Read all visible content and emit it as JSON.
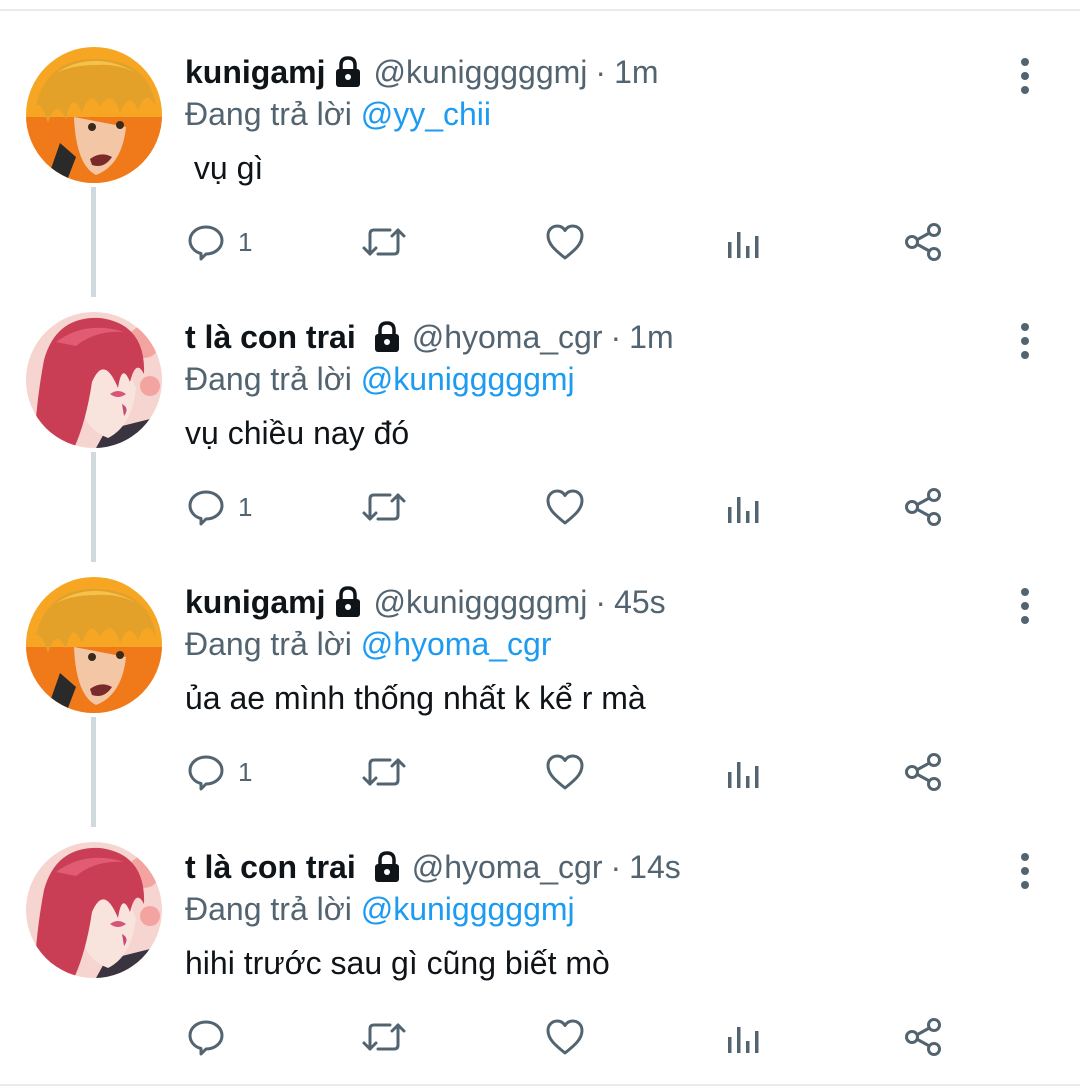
{
  "colors": {
    "text_primary": "#0f1419",
    "text_secondary": "#536471",
    "mention_blue": "#1d9bf0",
    "icon_gray": "#536471",
    "thread_line": "#cfd9de"
  },
  "icons": {
    "lock": "lock-icon",
    "more": "more-vertical-icon",
    "reply": "reply-icon",
    "retweet": "retweet-icon",
    "like": "heart-icon",
    "analytics": "analytics-icon",
    "share": "share-icon"
  },
  "tweets": [
    {
      "display_name": "kunigamj",
      "handle": "@kunigggggmj",
      "dot": "·",
      "time": "1m",
      "reply_prefix": "Đang trả lời",
      "reply_to": "@yy_chii",
      "text": " vụ gì",
      "reply_count": "1",
      "avatar": "orange-hair-avatar"
    },
    {
      "display_name": "t là con trai",
      "handle": "@hyoma_cgr",
      "dot": "·",
      "time": "1m",
      "reply_prefix": "Đang trả lời",
      "reply_to": "@kunigggggmj",
      "text": "vụ chiều nay đó",
      "reply_count": "1",
      "avatar": "pink-hair-avatar"
    },
    {
      "display_name": "kunigamj",
      "handle": "@kunigggggmj",
      "dot": "·",
      "time": "45s",
      "reply_prefix": "Đang trả lời",
      "reply_to": "@hyoma_cgr",
      "text": "ủa ae mình thống nhất k kể r mà",
      "reply_count": "1",
      "avatar": "orange-hair-avatar"
    },
    {
      "display_name": "t là con trai",
      "handle": "@hyoma_cgr",
      "dot": "·",
      "time": "14s",
      "reply_prefix": "Đang trả lời",
      "reply_to": "@kunigggggmj",
      "text": "hihi trước sau gì cũng biết mò",
      "reply_count": "",
      "avatar": "pink-hair-avatar"
    }
  ]
}
